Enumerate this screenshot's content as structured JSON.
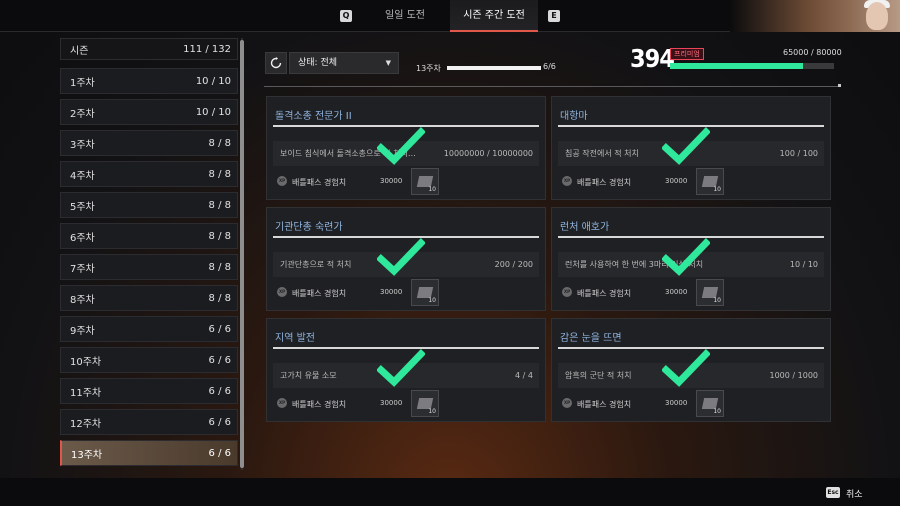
{
  "top_nav": {
    "prev_key": "Q",
    "next_key": "E",
    "tabs": [
      {
        "label": "일일 도전",
        "active": false
      },
      {
        "label": "시즌 주간 도전",
        "active": true
      }
    ]
  },
  "sidebar": {
    "items": [
      {
        "label": "시즌",
        "progress": "111 / 132"
      },
      {
        "label": "1주차",
        "progress": "10 / 10"
      },
      {
        "label": "2주차",
        "progress": "10 / 10"
      },
      {
        "label": "3주차",
        "progress": "8 / 8"
      },
      {
        "label": "4주차",
        "progress": "8 / 8"
      },
      {
        "label": "5주차",
        "progress": "8 / 8"
      },
      {
        "label": "6주차",
        "progress": "8 / 8"
      },
      {
        "label": "7주차",
        "progress": "8 / 8"
      },
      {
        "label": "8주차",
        "progress": "8 / 8"
      },
      {
        "label": "9주차",
        "progress": "6 / 6"
      },
      {
        "label": "10주차",
        "progress": "6 / 6"
      },
      {
        "label": "11주차",
        "progress": "6 / 6"
      },
      {
        "label": "12주차",
        "progress": "6 / 6"
      },
      {
        "label": "13주차",
        "progress": "6 / 6",
        "active": true
      }
    ]
  },
  "filter": {
    "status_select": "상태: 전체",
    "refresh_icon": "refresh-icon"
  },
  "week_progress": {
    "label": "13주차",
    "count": "6/6",
    "fraction": 1.0
  },
  "battlepass": {
    "level": "394",
    "tier": "프리미엄",
    "xp": "65000 / 80000",
    "fraction": 0.8125
  },
  "challenges": [
    {
      "title": "돌격소총 전문가 II",
      "task": "보이드 침식에서 돌격소총으로 적 처치…",
      "count": "10000000 / 10000000",
      "reward_label": "배틀패스 경험치",
      "reward_amount": "30000",
      "reward_mult": "10",
      "completed": true
    },
    {
      "title": "대항마",
      "task": "침공 작전에서 적 처치",
      "count": "100 / 100",
      "reward_label": "배틀패스 경험치",
      "reward_amount": "30000",
      "reward_mult": "10",
      "completed": true
    },
    {
      "title": "기관단총 숙련가",
      "task": "기관단총으로 적 처치",
      "count": "200 / 200",
      "reward_label": "배틀패스 경험치",
      "reward_amount": "30000",
      "reward_mult": "10",
      "completed": true
    },
    {
      "title": "런처 애호가",
      "task": "런처를 사용하여 한 번에 3마리 이상 처치",
      "count": "10 / 10",
      "reward_label": "배틀패스 경험치",
      "reward_amount": "30000",
      "reward_mult": "10",
      "completed": true
    },
    {
      "title": "지역 발전",
      "task": "고가치 유물 소모",
      "count": "4 / 4",
      "reward_label": "배틀패스 경험치",
      "reward_amount": "30000",
      "reward_mult": "10",
      "completed": true
    },
    {
      "title": "감은 눈을 뜨면",
      "task": "암흑의 군단 적 처치",
      "count": "1000 / 1000",
      "reward_label": "배틀패스 경험치",
      "reward_amount": "30000",
      "reward_mult": "10",
      "completed": true
    }
  ],
  "xp_badge": "XP",
  "footer": {
    "esc_key": "Esc",
    "cancel_label": "취소"
  },
  "colors": {
    "accent_red": "#e0584a",
    "xp_green": "#2fe89b",
    "check_green": "#2fe89b",
    "title_blue": "#8fb4e0",
    "premium_pink": "#ff6f7f"
  }
}
